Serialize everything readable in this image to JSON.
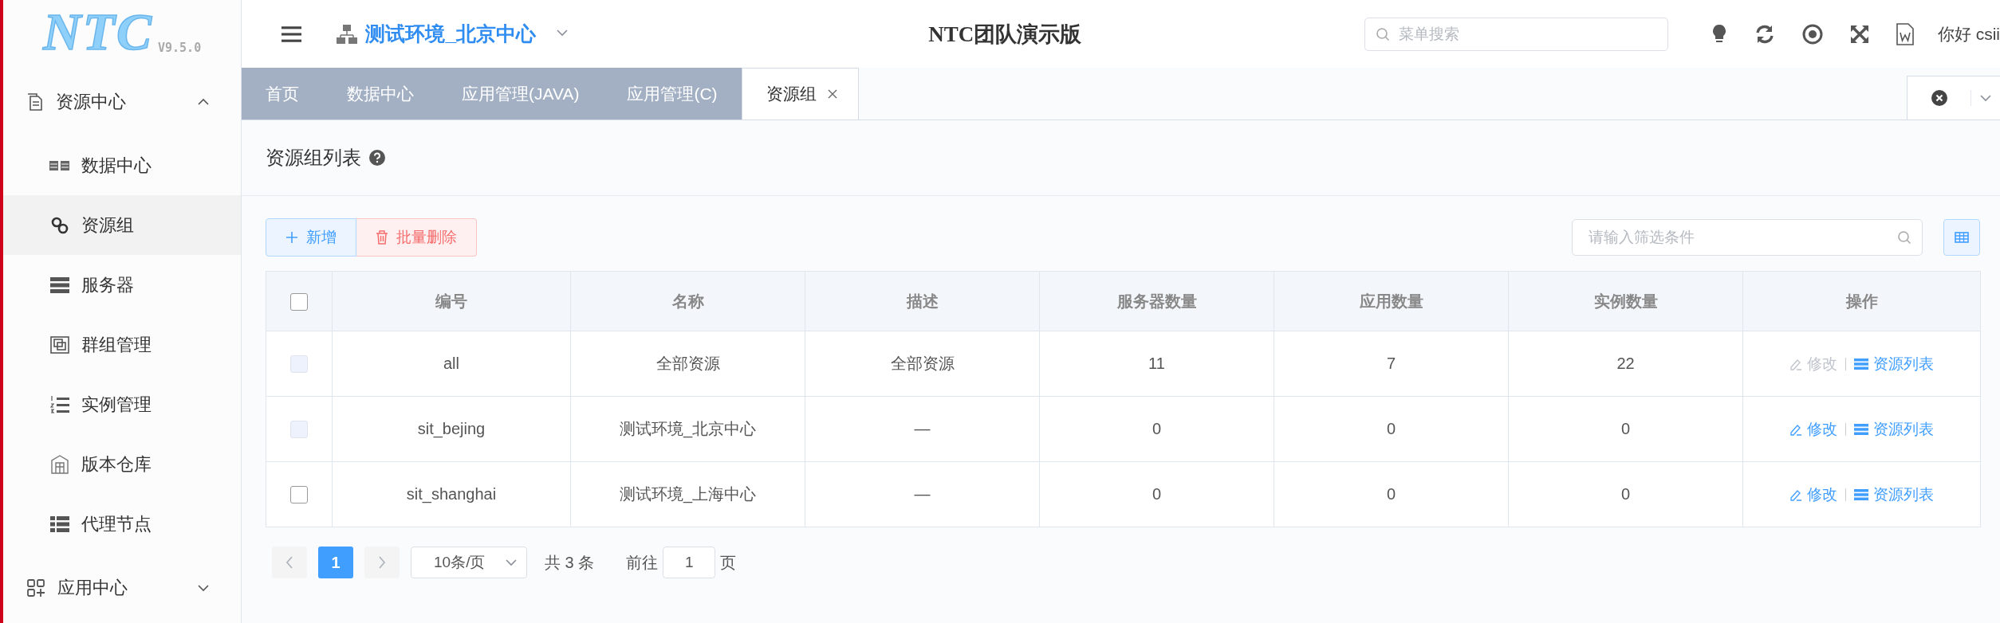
{
  "header": {
    "logo": "NTC",
    "version": "V9.5.0",
    "environment": "测试环境_北京中心",
    "title": "NTC团队演示版",
    "search": {
      "placeholder": "菜单搜索"
    },
    "greeting": "你好 csii"
  },
  "sidebar": {
    "groups": [
      {
        "label": "资源中心",
        "expanded": true,
        "children": [
          {
            "label": "数据中心",
            "selected": false
          },
          {
            "label": "资源组",
            "selected": true
          },
          {
            "label": "服务器",
            "selected": false
          },
          {
            "label": "群组管理",
            "selected": false
          },
          {
            "label": "实例管理",
            "selected": false
          },
          {
            "label": "版本仓库",
            "selected": false
          },
          {
            "label": "代理节点",
            "selected": false
          }
        ]
      },
      {
        "label": "应用中心",
        "expanded": false
      }
    ]
  },
  "tabs": [
    {
      "label": "首页",
      "selected": false,
      "closable": false
    },
    {
      "label": "数据中心",
      "selected": false,
      "closable": false
    },
    {
      "label": "应用管理(JAVA)",
      "selected": false,
      "closable": false
    },
    {
      "label": "应用管理(C)",
      "selected": false,
      "closable": false
    },
    {
      "label": "资源组",
      "selected": true,
      "closable": true
    }
  ],
  "page": {
    "title": "资源组列表"
  },
  "toolbar": {
    "buttons": [
      {
        "label": "新增",
        "kind": "add"
      },
      {
        "label": "批量删除",
        "kind": "delete"
      }
    ],
    "filter": {
      "placeholder": "请输入筛选条件"
    }
  },
  "table": {
    "select_all_checked": false,
    "columns": [
      "编号",
      "名称",
      "描述",
      "服务器数量",
      "应用数量",
      "实例数量",
      "操作"
    ],
    "rows": [
      {
        "checked": false,
        "disabled": true,
        "cells": [
          "all",
          "全部资源",
          "全部资源",
          "11",
          "7",
          "22"
        ],
        "actions": [
          {
            "label": "修改",
            "kind": "edit",
            "disabled": true
          },
          {
            "label": "资源列表",
            "kind": "list",
            "disabled": false
          }
        ]
      },
      {
        "checked": false,
        "disabled": true,
        "cells": [
          "sit_bejing",
          "测试环境_北京中心",
          "—",
          "0",
          "0",
          "0"
        ],
        "actions": [
          {
            "label": "修改",
            "kind": "edit",
            "disabled": false
          },
          {
            "label": "资源列表",
            "kind": "list",
            "disabled": false
          }
        ]
      },
      {
        "checked": false,
        "disabled": false,
        "cells": [
          "sit_shanghai",
          "测试环境_上海中心",
          "—",
          "0",
          "0",
          "0"
        ],
        "actions": [
          {
            "label": "修改",
            "kind": "edit",
            "disabled": false
          },
          {
            "label": "资源列表",
            "kind": "list",
            "disabled": false
          }
        ]
      }
    ]
  },
  "pagination": {
    "pages": [
      {
        "label": "1",
        "selected": true
      }
    ],
    "page_size": "10条/页",
    "total": "共 3 条",
    "goto_label": "前往",
    "goto_value": "1",
    "goto_suffix": "页"
  }
}
